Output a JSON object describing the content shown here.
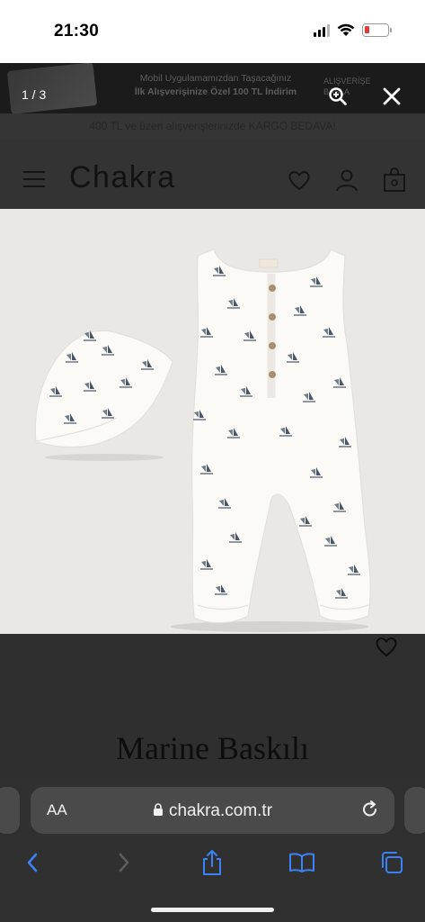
{
  "status_bar": {
    "time": "21:30"
  },
  "promo": {
    "line1": "Mobil Uygulamamızdan Taşacağınız",
    "line2": "İlk Alışverişinize Özel 100 TL İndirim",
    "cta": "ALIŞVERİŞE BAŞLA"
  },
  "shipping_notice": "400 TL ve üzeri alışverişlerinizde KARGO BEDAVA!",
  "site": {
    "logo": "Chakra"
  },
  "lightbox": {
    "counter": "1 / 3"
  },
  "product": {
    "title": "Marine Baskılı"
  },
  "safari": {
    "text_size_label": "AA",
    "url": "chakra.com.tr"
  },
  "colors": {
    "battery_low": "#e53935",
    "safari_accent": "#3b82f6",
    "image_bg": "#ebe7e4"
  }
}
